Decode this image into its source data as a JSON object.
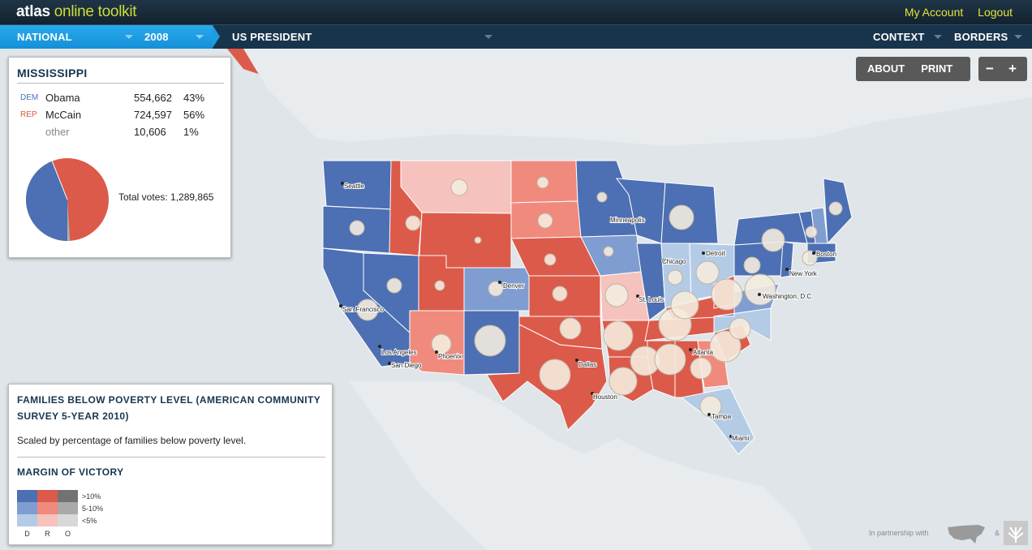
{
  "app": {
    "brand_bold": "atlas",
    "brand_rest": " online toolkit"
  },
  "header": {
    "account": "My Account",
    "logout": "Logout"
  },
  "nav": {
    "scope": "NATIONAL",
    "year": "2008",
    "race": "US PRESIDENT",
    "context": "CONTEXT",
    "borders": "BORDERS"
  },
  "controls": {
    "about": "ABOUT",
    "print": "PRINT",
    "zoom_out": "−",
    "zoom_in": "+"
  },
  "info": {
    "state": "MISSISSIPPI",
    "rows": [
      {
        "party": "DEM",
        "name": "Obama",
        "votes": "554,662",
        "pct": "43%"
      },
      {
        "party": "REP",
        "name": "McCain",
        "votes": "724,597",
        "pct": "56%"
      },
      {
        "party": "",
        "name": "other",
        "votes": "10,606",
        "pct": "1%"
      }
    ],
    "total": "Total votes: 1,289,865"
  },
  "legend": {
    "title_line1": "FAMILIES BELOW POVERTY LEVEL (AMERICAN COMMUNITY",
    "title_line2": "SURVEY 5-YEAR 2010)",
    "description": "Scaled by percentage of families below poverty level.",
    "margin_title": "MARGIN OF VICTORY",
    "levels": [
      ">10%",
      "5-10%",
      "<5%"
    ],
    "columns": [
      "D",
      "R",
      "O"
    ]
  },
  "cities": [
    "Seattle",
    "Minneapolis",
    "Detroit",
    "Boston",
    "Chicago",
    "Denver",
    "New York",
    "San Francisco",
    "St. Louis",
    "Washington, D.C.",
    "Los Angeles",
    "San Diego",
    "Phoenix",
    "Atlanta",
    "Dallas",
    "Houston",
    "Tampa",
    "Miami"
  ],
  "footer": {
    "partner": "In partnership with",
    "amp": "&"
  },
  "colors": {
    "dem_strong": "#4d6fb3",
    "dem_mid": "#7f9dd0",
    "dem_light": "#b4cbe6",
    "rep_strong": "#dc5a4a",
    "rep_mid": "#ef8a7d",
    "rep_light": "#f6c2bd",
    "other_strong": "#727272",
    "other_mid": "#a9a9a9",
    "other_light": "#d8d8d8",
    "bubble": "#f4ebde"
  }
}
